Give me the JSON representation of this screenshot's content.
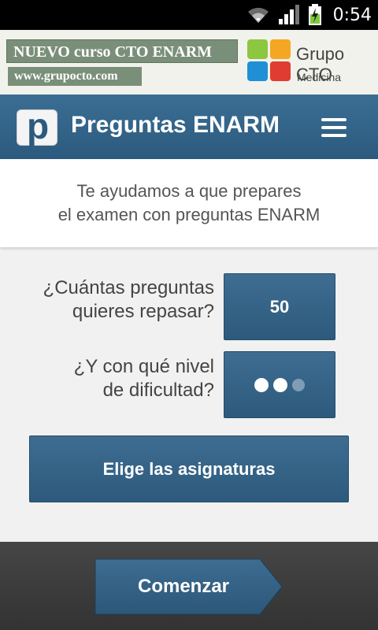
{
  "status_bar": {
    "time": "0:54",
    "icons": [
      "wifi-icon",
      "signal-icon",
      "battery-charging-icon"
    ]
  },
  "ad": {
    "headline": "NUEVO curso CTO ENARM",
    "url": "www.grupocto.com",
    "brand_name_prefix": "Grupo",
    "brand_name_suffix": "CTO",
    "brand_subtitle": "Medicina",
    "logo_colors": [
      "#8dc63f",
      "#f5a623",
      "#1f8fd6",
      "#e03c31"
    ]
  },
  "header": {
    "logo_letter": "p",
    "title": "Preguntas ENARM",
    "menu_icon": "hamburger-menu-icon"
  },
  "intro": {
    "line1": "Te ayudamos a que prepares",
    "line2": "el examen con preguntas ENARM"
  },
  "questions": {
    "count_label_line1": "¿Cuántas preguntas",
    "count_label_line2": "quieres repasar?",
    "count_value": "50",
    "difficulty_label_line1": "¿Y con qué nivel",
    "difficulty_label_line2": "de dificultad?",
    "difficulty_level": 2,
    "difficulty_max": 3
  },
  "subjects_button": "Elige las asignaturas",
  "start_button": "Comenzar",
  "colors": {
    "primary": "#2f5d80",
    "header": "#336487",
    "ad_green": "#7a8f79",
    "footer": "#3d3d3d"
  }
}
